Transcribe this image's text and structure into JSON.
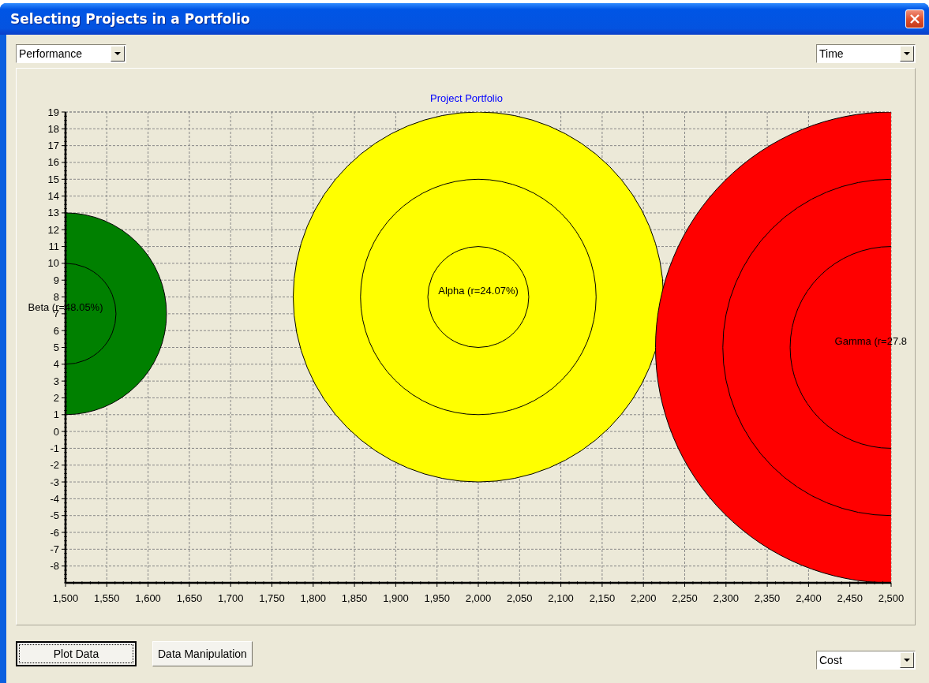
{
  "window": {
    "title": "Selecting Projects in a Portfolio"
  },
  "y_selector": {
    "value": "Performance"
  },
  "x_selector": {
    "value": "Time"
  },
  "chart": {
    "chart_data": {
      "type": "scatter",
      "title": "Project Portfolio",
      "x": [
        1500,
        2000,
        2500
      ],
      "series": [
        {
          "name": "Beta (r=48.05%)",
          "color": "#008000",
          "values": [
            7,
            null,
            null
          ]
        },
        {
          "name": "Alpha (r=24.07%)",
          "color": "#ffff00",
          "values": [
            null,
            8,
            null
          ]
        },
        {
          "name": "Gamma (r=27.8",
          "color": "#ff0000",
          "values": [
            null,
            null,
            5
          ]
        }
      ],
      "grid": true,
      "xlim": [
        1500,
        2500
      ],
      "ylim": [
        -9,
        19
      ],
      "xticks": [
        {
          "value": 1500,
          "label": "1,500"
        },
        {
          "value": 1550,
          "label": "1,550"
        },
        {
          "value": 1600,
          "label": "1,600"
        },
        {
          "value": 1650,
          "label": "1,650"
        },
        {
          "value": 1700,
          "label": "1,700"
        },
        {
          "value": 1750,
          "label": "1,750"
        },
        {
          "value": 1800,
          "label": "1,800"
        },
        {
          "value": 1850,
          "label": "1,850"
        },
        {
          "value": 1900,
          "label": "1,900"
        },
        {
          "value": 1950,
          "label": "1,950"
        },
        {
          "value": 2000,
          "label": "2,000"
        },
        {
          "value": 2050,
          "label": "2,050"
        },
        {
          "value": 2100,
          "label": "2,100"
        },
        {
          "value": 2150,
          "label": "2,150"
        },
        {
          "value": 2200,
          "label": "2,200"
        },
        {
          "value": 2250,
          "label": "2,250"
        },
        {
          "value": 2300,
          "label": "2,300"
        },
        {
          "value": 2350,
          "label": "2,350"
        },
        {
          "value": 2400,
          "label": "2,400"
        },
        {
          "value": 2450,
          "label": "2,450"
        },
        {
          "value": 2500,
          "label": "2,500"
        }
      ],
      "yticks": [
        -8,
        -7,
        -6,
        -5,
        -4,
        -3,
        -2,
        -1,
        0,
        1,
        2,
        3,
        4,
        5,
        6,
        7,
        8,
        9,
        10,
        11,
        12,
        13,
        14,
        15,
        16,
        17,
        18,
        19
      ]
    }
  },
  "buttons": [
    {
      "label": "Plot Data",
      "focused": true
    },
    {
      "label": "Data Manipulation",
      "focused": false
    }
  ],
  "size_selector": {
    "value": "Cost"
  }
}
